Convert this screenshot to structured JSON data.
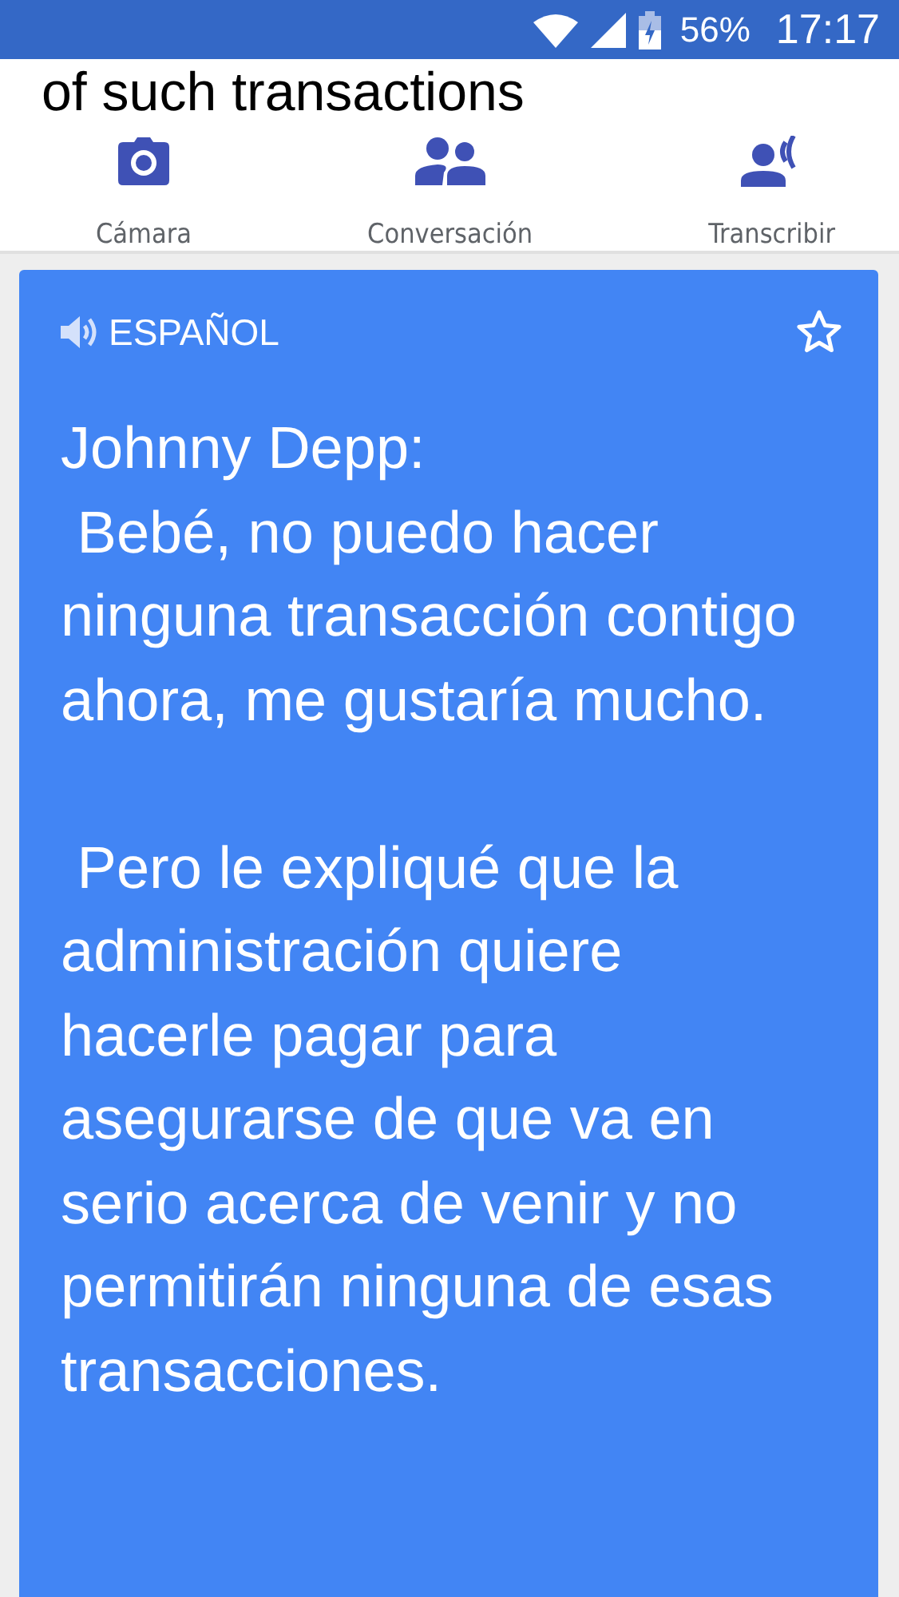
{
  "status_bar": {
    "battery": "56%",
    "time": "17:17"
  },
  "source_text": "of such transactions",
  "modes": [
    {
      "label": "Cámara",
      "kind": "camera"
    },
    {
      "label": "Conversación",
      "kind": "conversation"
    },
    {
      "label": "Transcribir",
      "kind": "transcribe"
    }
  ],
  "result": {
    "language": "ESPAÑOL",
    "starred": false,
    "text": "Johnny Depp:\n Bebé, no puedo hacer ninguna transacción contigo ahora, me gustaría mucho.\n\n Pero le expliqué que la administración quiere hacerle pagar para asegurarse de que va en serio acerca de venir y no permitirán ninguna de esas transacciones."
  }
}
